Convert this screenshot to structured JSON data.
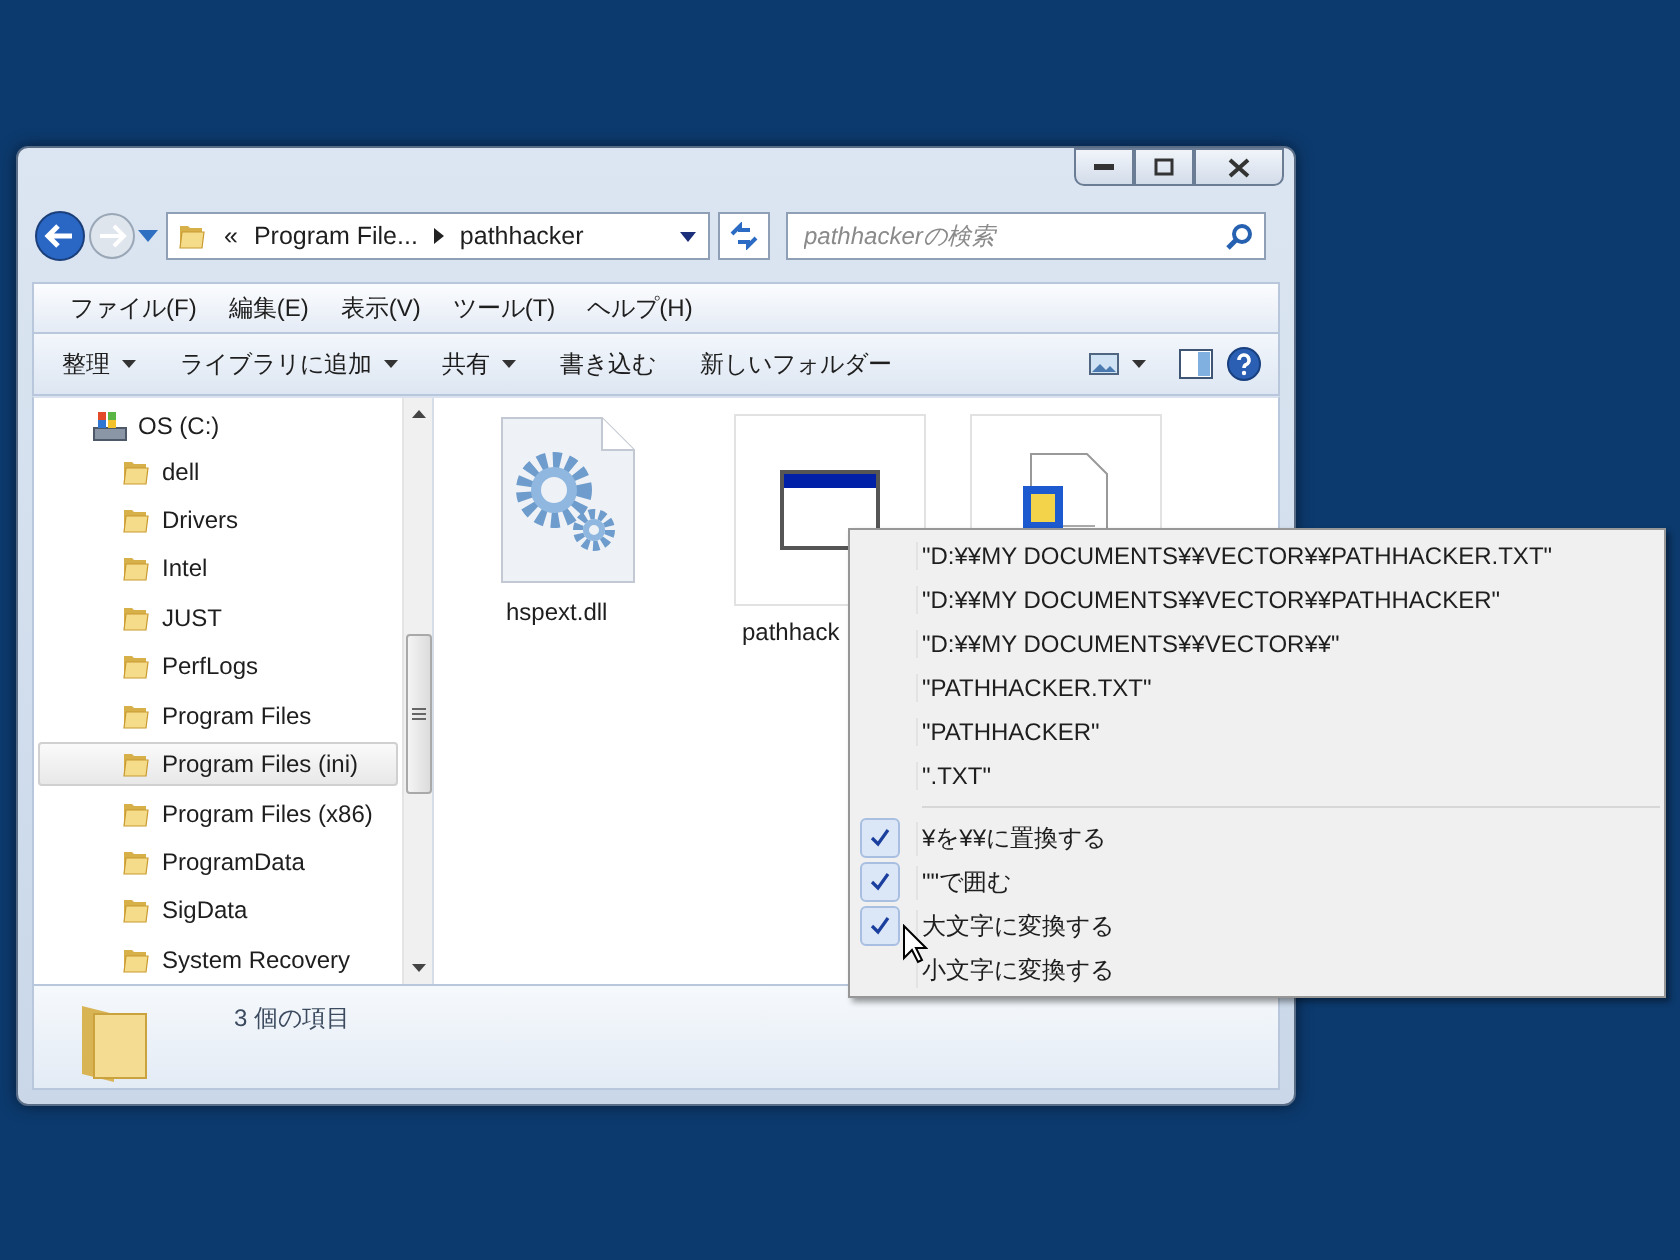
{
  "address": {
    "overflow": "«",
    "crumbs": [
      "Program File...",
      "pathhacker"
    ]
  },
  "search": {
    "placeholder": "pathhackerの検索"
  },
  "menu_bar": [
    "ファイル(F)",
    "編集(E)",
    "表示(V)",
    "ツール(T)",
    "ヘルプ(H)"
  ],
  "command_bar": [
    {
      "label": "整理",
      "dropdown": true
    },
    {
      "label": "ライブラリに追加",
      "dropdown": true
    },
    {
      "label": "共有",
      "dropdown": true
    },
    {
      "label": "書き込む",
      "dropdown": false
    },
    {
      "label": "新しいフォルダー",
      "dropdown": false
    }
  ],
  "sidebar": {
    "drive": "OS (C:)",
    "items": [
      {
        "label": "dell",
        "selected": false
      },
      {
        "label": "Drivers",
        "selected": false
      },
      {
        "label": "Intel",
        "selected": false
      },
      {
        "label": "JUST",
        "selected": false
      },
      {
        "label": "PerfLogs",
        "selected": false
      },
      {
        "label": "Program Files",
        "selected": false
      },
      {
        "label": "Program Files (ini)",
        "selected": true
      },
      {
        "label": "Program Files (x86)",
        "selected": false
      },
      {
        "label": "ProgramData",
        "selected": false
      },
      {
        "label": "SigData",
        "selected": false
      },
      {
        "label": "System Recovery",
        "selected": false
      }
    ]
  },
  "files": [
    {
      "kind": "dll",
      "name": "hspext.dll"
    },
    {
      "kind": "exe",
      "name": "pathhack"
    },
    {
      "kind": "doc"
    }
  ],
  "status": "3 個の項目",
  "context_menu": [
    {
      "kind": "path",
      "label": "\"D:¥¥MY DOCUMENTS¥¥VECTOR¥¥PATHHACKER.TXT\""
    },
    {
      "kind": "path",
      "label": "\"D:¥¥MY DOCUMENTS¥¥VECTOR¥¥PATHHACKER\""
    },
    {
      "kind": "path",
      "label": "\"D:¥¥MY DOCUMENTS¥¥VECTOR¥¥\""
    },
    {
      "kind": "path",
      "label": "\"PATHHACKER.TXT\""
    },
    {
      "kind": "path",
      "label": "\"PATHHACKER\""
    },
    {
      "kind": "path",
      "label": "\".TXT\""
    },
    {
      "kind": "option",
      "label": "¥を¥¥に置換する",
      "checked": true
    },
    {
      "kind": "option",
      "label": "\"\"で囲む",
      "checked": true
    },
    {
      "kind": "option",
      "label": "大文字に変換する",
      "checked": true
    },
    {
      "kind": "option",
      "label": "小文字に変換する",
      "checked": false
    }
  ]
}
